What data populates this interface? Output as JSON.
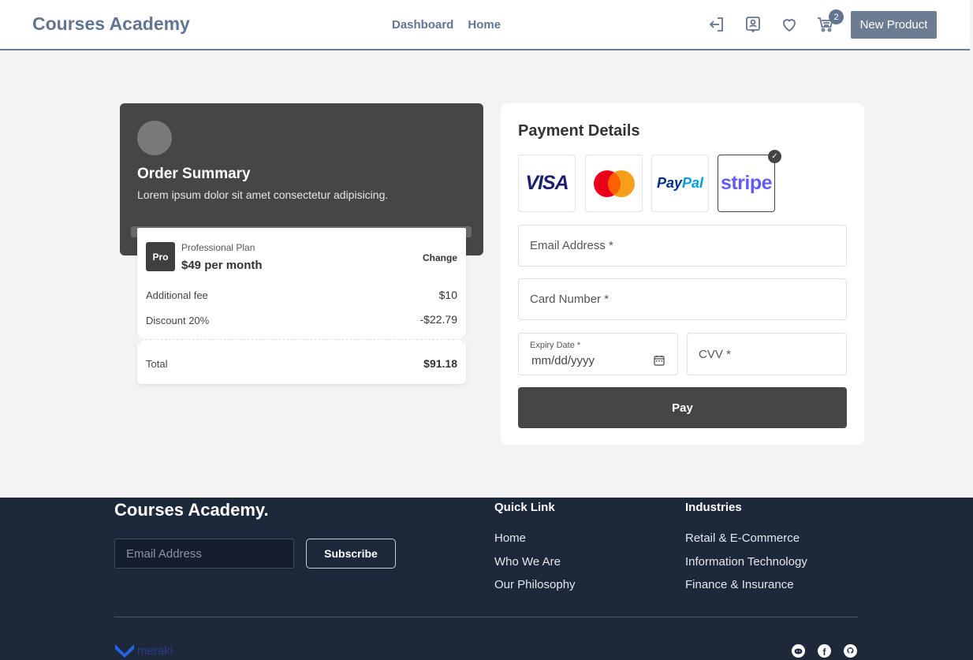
{
  "header": {
    "brand": "Courses Academy",
    "nav": [
      "Dashboard",
      "Home"
    ],
    "icons": [
      "logout-icon",
      "profile-icon",
      "heart-icon",
      "cart-icon"
    ],
    "cart_count": "2",
    "new_product_label": "New Product"
  },
  "order": {
    "title": "Order Summary",
    "subtitle": "Lorem ipsum dolor sit amet consectetur adipisicing.",
    "plan_badge": "Pro",
    "plan_name": "Professional Plan",
    "plan_price": "$49 per month",
    "change_label": "Change",
    "additional_fee_label": "Additional fee",
    "additional_fee_value": "$10",
    "discount_label": "Discount 20%",
    "discount_value": "-$22.79",
    "total_label": "Total",
    "total_value": "$91.18"
  },
  "payment": {
    "title": "Payment Details",
    "methods": [
      "VISA",
      "Mastercard",
      "PayPal",
      "stripe"
    ],
    "selected_method": "stripe",
    "email_placeholder": "Email Address *",
    "card_placeholder": "Card Number *",
    "expiry_label": "Expiry Date *",
    "expiry_value": "mm/dd/yyyy",
    "cvv_placeholder": "CVV *",
    "pay_label": "Pay"
  },
  "footer": {
    "brand": "Courses Academy.",
    "email_placeholder": "Email Address",
    "subscribe_label": "Subscribe",
    "quick_link_title": "Quick Link",
    "quick_links": [
      "Home",
      "Who We Are",
      "Our Philosophy"
    ],
    "industries_title": "Industries",
    "industries": [
      "Retail & E-Commerce",
      "Information Technology",
      "Finance & Insurance"
    ],
    "logo_text": "meraki",
    "social_icons": [
      "reddit-icon",
      "facebook-icon",
      "github-icon"
    ]
  },
  "colors": {
    "primary": "#627590",
    "dark": "#464646",
    "footer_bg": "#1d283a",
    "visa": "#1a1f71",
    "mc_red": "#eb001b",
    "mc_orange": "#f79e1b",
    "paypal_dark": "#003087",
    "paypal_light": "#009cde",
    "stripe": "#635bff"
  }
}
